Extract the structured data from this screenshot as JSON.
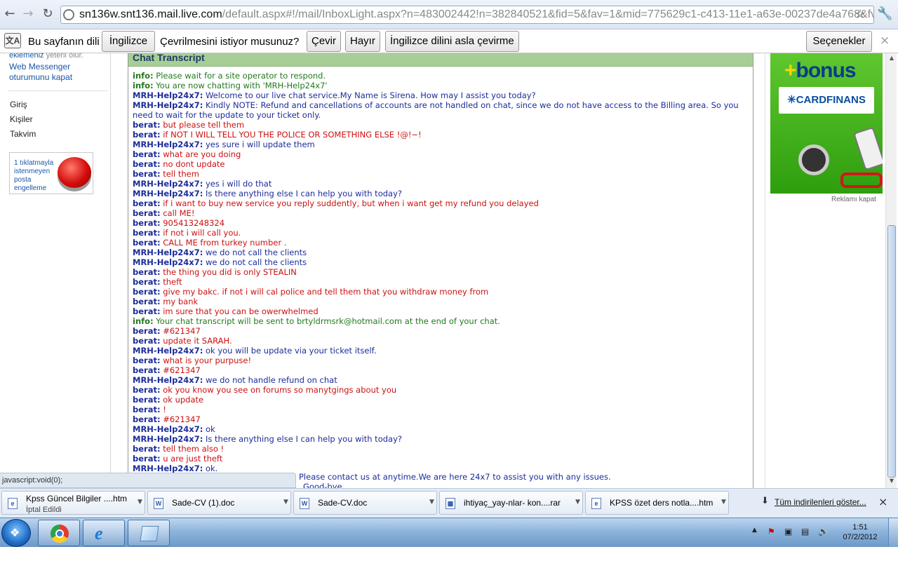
{
  "browser": {
    "url_host": "sn136w.snt136.mail.live.com",
    "url_rest": "/default.aspx#!/mail/InboxLight.aspx?n=483002442!n=382840521&fid=5&fav=1&mid=775629c1-c413-11e1-a63e-00237de4a768&fv=1",
    "icons": {
      "back": "back-arrow-icon",
      "forward": "forward-arrow-icon",
      "reload": "reload-icon",
      "bookmark": "star-icon",
      "menu": "wrench-icon"
    }
  },
  "translate_bar": {
    "icon_label": "文A",
    "prompt": "Bu sayfanın dili",
    "language": "İngilizce",
    "question": "Çevrilmesini istiyor musunuz?",
    "translate_label": "Çevir",
    "no_label": "Hayır",
    "never_label": "İngilizce dilini asla çevirme",
    "options_label": "Seçenekler",
    "close": "×"
  },
  "sidebar": {
    "top_text_link": "eklemeniz",
    "top_text_rest": " yeterli olur.",
    "link1": "Web Messenger",
    "link2": "oturumunu kapat",
    "items": [
      {
        "label": "Giriş"
      },
      {
        "label": "Kişiler"
      },
      {
        "label": "Takvim"
      }
    ],
    "spam_text": "1 tıklatmayla istenmeyen posta engelleme"
  },
  "chat": {
    "title": "Chat Transcript",
    "messages": [
      {
        "kind": "info",
        "speaker": "info:",
        "text": "Please wait for a site operator to respond."
      },
      {
        "kind": "info",
        "speaker": "info:",
        "text": "You are now chatting with 'MRH-Help24x7'"
      },
      {
        "kind": "agent",
        "speaker": "MRH-Help24x7:",
        "text": "Welcome to our live chat service.My Name is Sirena. How may I assist you today?"
      },
      {
        "kind": "agent",
        "speaker": "MRH-Help24x7:",
        "text": "Kindly NOTE: Refund and cancellations of accounts are not handled on chat, since we do not have access to the Billing area. So you need to wait for the update to your ticket only."
      },
      {
        "kind": "user",
        "speaker": "berat:",
        "text": "but please tell them"
      },
      {
        "kind": "user",
        "speaker": "berat:",
        "text": "if NOT I WILL TELL YOU THE POLICE OR SOMETHING ELSE !@!~!"
      },
      {
        "kind": "agent",
        "speaker": "MRH-Help24x7:",
        "text": "yes sure i will update them"
      },
      {
        "kind": "user",
        "speaker": "berat:",
        "text": "what are you doing"
      },
      {
        "kind": "user",
        "speaker": "berat:",
        "text": "no dont update"
      },
      {
        "kind": "user",
        "speaker": "berat:",
        "text": "tell them"
      },
      {
        "kind": "agent",
        "speaker": "MRH-Help24x7:",
        "text": "yes i will do that"
      },
      {
        "kind": "agent",
        "speaker": "MRH-Help24x7:",
        "text": "Is there anything else I can help you with today?"
      },
      {
        "kind": "user",
        "speaker": "berat:",
        "text": "if i want to buy new service you reply suddently, but when i want get my refund you delayed"
      },
      {
        "kind": "user",
        "speaker": "berat:",
        "text": "call ME!"
      },
      {
        "kind": "user",
        "speaker": "berat:",
        "text": "905413248324"
      },
      {
        "kind": "user",
        "speaker": "berat:",
        "text": "if not i will call you."
      },
      {
        "kind": "user",
        "speaker": "berat:",
        "text": "CALL ME from turkey number ."
      },
      {
        "kind": "agent",
        "speaker": "MRH-Help24x7:",
        "text": "we do not call the clients"
      },
      {
        "kind": "agent",
        "speaker": "MRH-Help24x7:",
        "text": "we do not call the clients"
      },
      {
        "kind": "user",
        "speaker": "berat:",
        "text": "the thing you did is only STEALIN"
      },
      {
        "kind": "user",
        "speaker": "berat:",
        "text": "theft"
      },
      {
        "kind": "user",
        "speaker": "berat:",
        "text": "give my bakc. if not i will cal police and tell them that you withdraw money from"
      },
      {
        "kind": "user",
        "speaker": "berat:",
        "text": "my bank"
      },
      {
        "kind": "user",
        "speaker": "berat:",
        "text": "im sure that you can be owerwhelmed"
      },
      {
        "kind": "info",
        "speaker": "info:",
        "text": "Your chat transcript will be sent to brtyldrmsrk@hotmail.com at the end of your chat."
      },
      {
        "kind": "user",
        "speaker": "berat:",
        "text": "#621347"
      },
      {
        "kind": "user",
        "speaker": "berat:",
        "text": "update it SARAH."
      },
      {
        "kind": "agent",
        "speaker": "MRH-Help24x7:",
        "text": "ok you will be update via your ticket itself."
      },
      {
        "kind": "user",
        "speaker": "berat:",
        "text": "what is your purpuse!"
      },
      {
        "kind": "user",
        "speaker": "berat:",
        "text": "#621347"
      },
      {
        "kind": "agent",
        "speaker": "MRH-Help24x7:",
        "text": "we do not handle refund on chat"
      },
      {
        "kind": "user",
        "speaker": "berat:",
        "text": "ok you know you see on forums so manytgings about you"
      },
      {
        "kind": "user",
        "speaker": "berat:",
        "text": "ok update"
      },
      {
        "kind": "user",
        "speaker": "berat:",
        "text": "!"
      },
      {
        "kind": "user",
        "speaker": "berat:",
        "text": "#621347"
      },
      {
        "kind": "agent",
        "speaker": "MRH-Help24x7:",
        "text": "ok"
      },
      {
        "kind": "agent",
        "speaker": "MRH-Help24x7:",
        "text": "Is there anything else I can help you with today?"
      },
      {
        "kind": "user",
        "speaker": "berat:",
        "text": "tell them also !"
      },
      {
        "kind": "user",
        "speaker": "berat:",
        "text": "u are just theft"
      },
      {
        "kind": "agent",
        "speaker": "MRH-Help24x7:",
        "text": "ok."
      }
    ],
    "tail_line1": "Please contact us at anytime.We are here 24x7 to assist you with any issues.",
    "tail_line2": "Good-bye"
  },
  "status_url": "javascript:void(0);",
  "ad": {
    "plus": "+",
    "bonus": "bonus",
    "card": "✳CARDFINANS",
    "close_label": "Reklamı kapat"
  },
  "downloads": {
    "items": [
      {
        "name": "Kpss Güncel Bilgiler ....htm",
        "status": "İptal Edildi",
        "icon": "htm-file-icon"
      },
      {
        "name": "Sade-CV (1).doc",
        "status": "",
        "icon": "doc-file-icon"
      },
      {
        "name": "Sade-CV.doc",
        "status": "",
        "icon": "doc-file-icon"
      },
      {
        "name": "ihtiyaç_yay-nlar- kon....rar",
        "status": "",
        "icon": "rar-file-icon"
      },
      {
        "name": "KPSS özet ders notla....htm",
        "status": "",
        "icon": "htm-file-icon"
      }
    ],
    "show_all_label": "Tüm indirilenleri göster...",
    "close": "×"
  },
  "taskbar": {
    "apps": [
      "chrome-icon",
      "internet-explorer-icon",
      "notepad-icon"
    ],
    "time": "1:51",
    "date": "07/2/2012"
  },
  "colors": {
    "chat_header": "#a7cf95",
    "info_text": "#237a1e",
    "agent_text": "#1c2d9a",
    "user_text": "#cc1111",
    "link": "#1b56a8"
  }
}
